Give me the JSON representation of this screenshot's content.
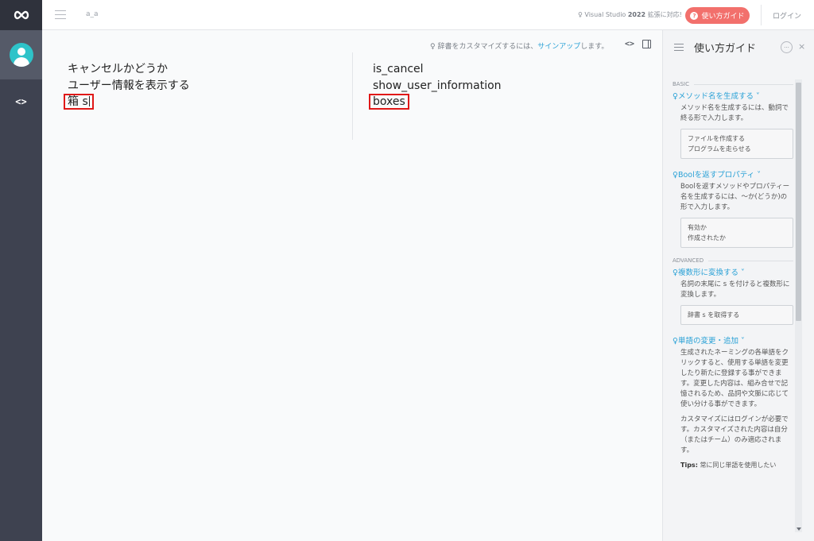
{
  "header": {
    "doc_name": "a_a",
    "vs_notice_prefix": "Visual Studio",
    "vs_notice_version": "2022",
    "vs_notice_suffix": "拡張に対応!",
    "guide_button_label": "使い方ガイド",
    "login_label": "ログイン"
  },
  "sidebar": {
    "logo_icon": "infinity-logo",
    "avatar_icon": "user-avatar-icon",
    "code_label": "<>"
  },
  "main": {
    "hint_prefix": "辞書をカスタマイズするには、",
    "hint_link": "サインアップ",
    "hint_suffix": "します。",
    "tool_code_label": "<>",
    "input_lines": [
      "キャンセルかどうか",
      "ユーザー情報を表示する"
    ],
    "input_current": "箱 s",
    "output_lines": [
      "is_cancel",
      "show_user_information"
    ],
    "output_current": "boxes",
    "highlight_color": "#e01818"
  },
  "guide": {
    "title": "使い方ガイド",
    "more_label": "···",
    "close_label": "×",
    "basic_label": "BASIC",
    "advanced_label": "ADVANCED",
    "items": [
      {
        "title": "メソッド名を生成する",
        "desc": "メソッド名を生成するには、動詞で終る形で入力します。",
        "example": [
          "ファイルを作成する",
          "プログラムを走らせる"
        ]
      },
      {
        "title": "Boolを返すプロパティ",
        "desc": "Boolを返すメソッドやプロパティー名を生成するには、〜か(どうか)の形で入力します。",
        "example": [
          "有効か",
          "作成されたか"
        ]
      },
      {
        "title": "複数形に変換する",
        "desc": "名詞の末尾に s を付けると複数形に変換します。",
        "example": [
          "辞書 s を取得する"
        ]
      },
      {
        "title": "単語の変更・追加",
        "desc": "生成されたネーミングの各単語をクリックすると、使用する単語を変更したり新たに登録する事ができます。変更した内容は、組み合せで記憶されるため、品詞や文脈に応じて使い分ける事ができます。",
        "desc2": "カスタマイズにはログインが必要です。カスタマイズされた内容は自分（またはチーム）のみ適応されます。"
      }
    ],
    "tip_label": "Tips:",
    "tip_text": "常に同じ単語を使用したい"
  },
  "colors": {
    "rail": "#3e4250",
    "accent": "#2aa1d6",
    "guide_button": "#f2706c",
    "avatar": "#2ec3c9"
  }
}
